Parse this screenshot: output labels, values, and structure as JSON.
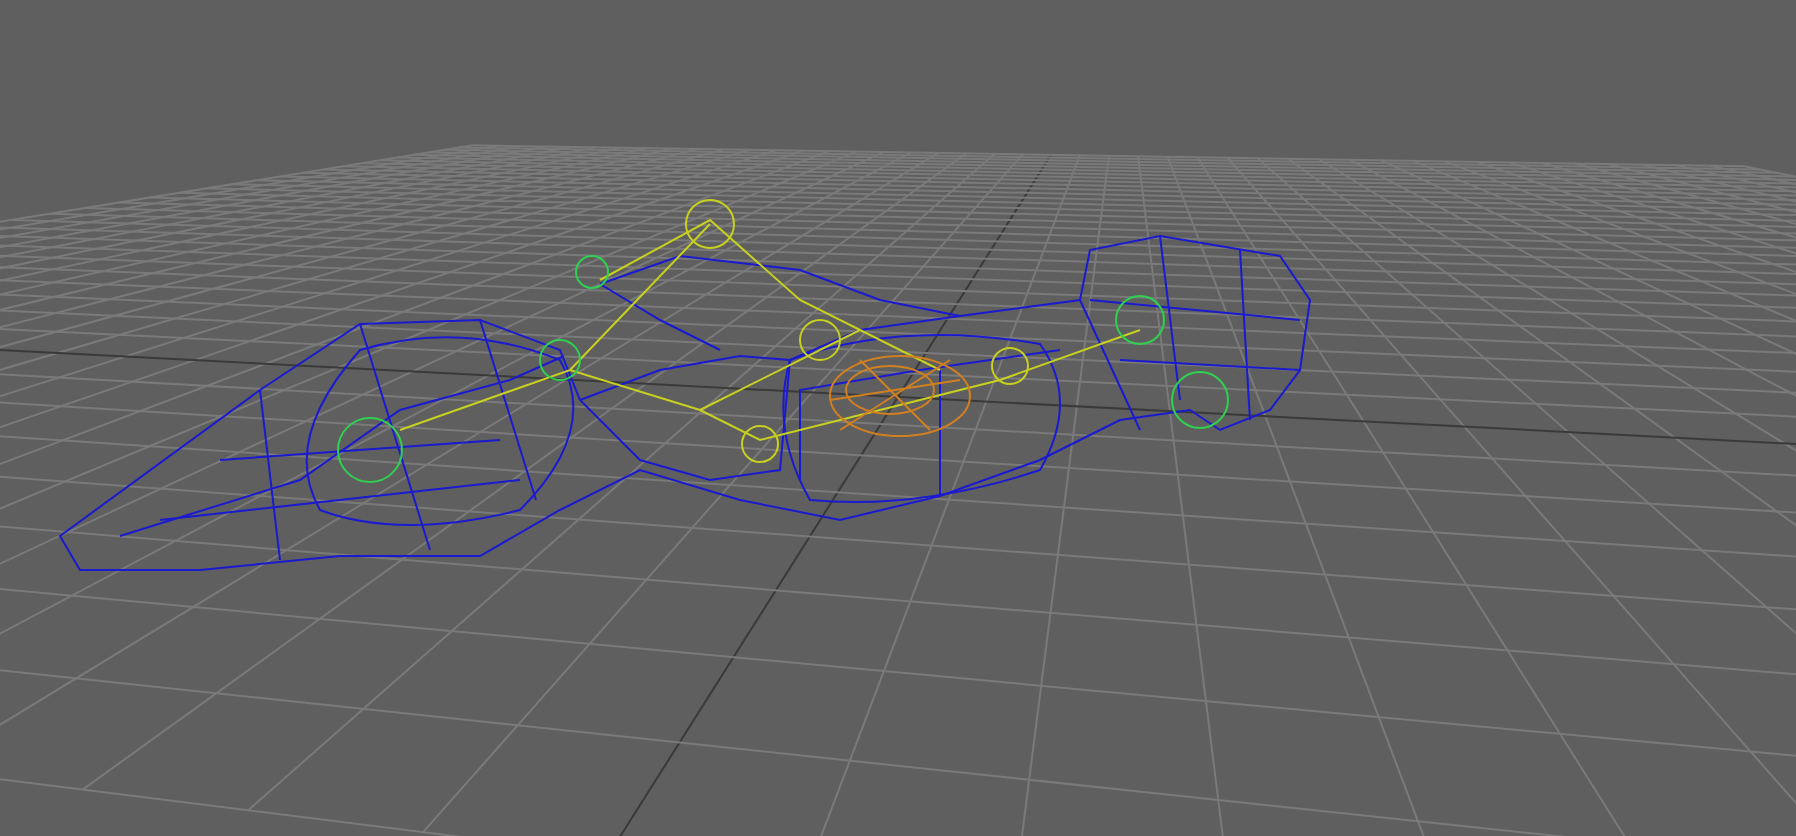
{
  "viewport": {
    "show_grid": true
  }
}
